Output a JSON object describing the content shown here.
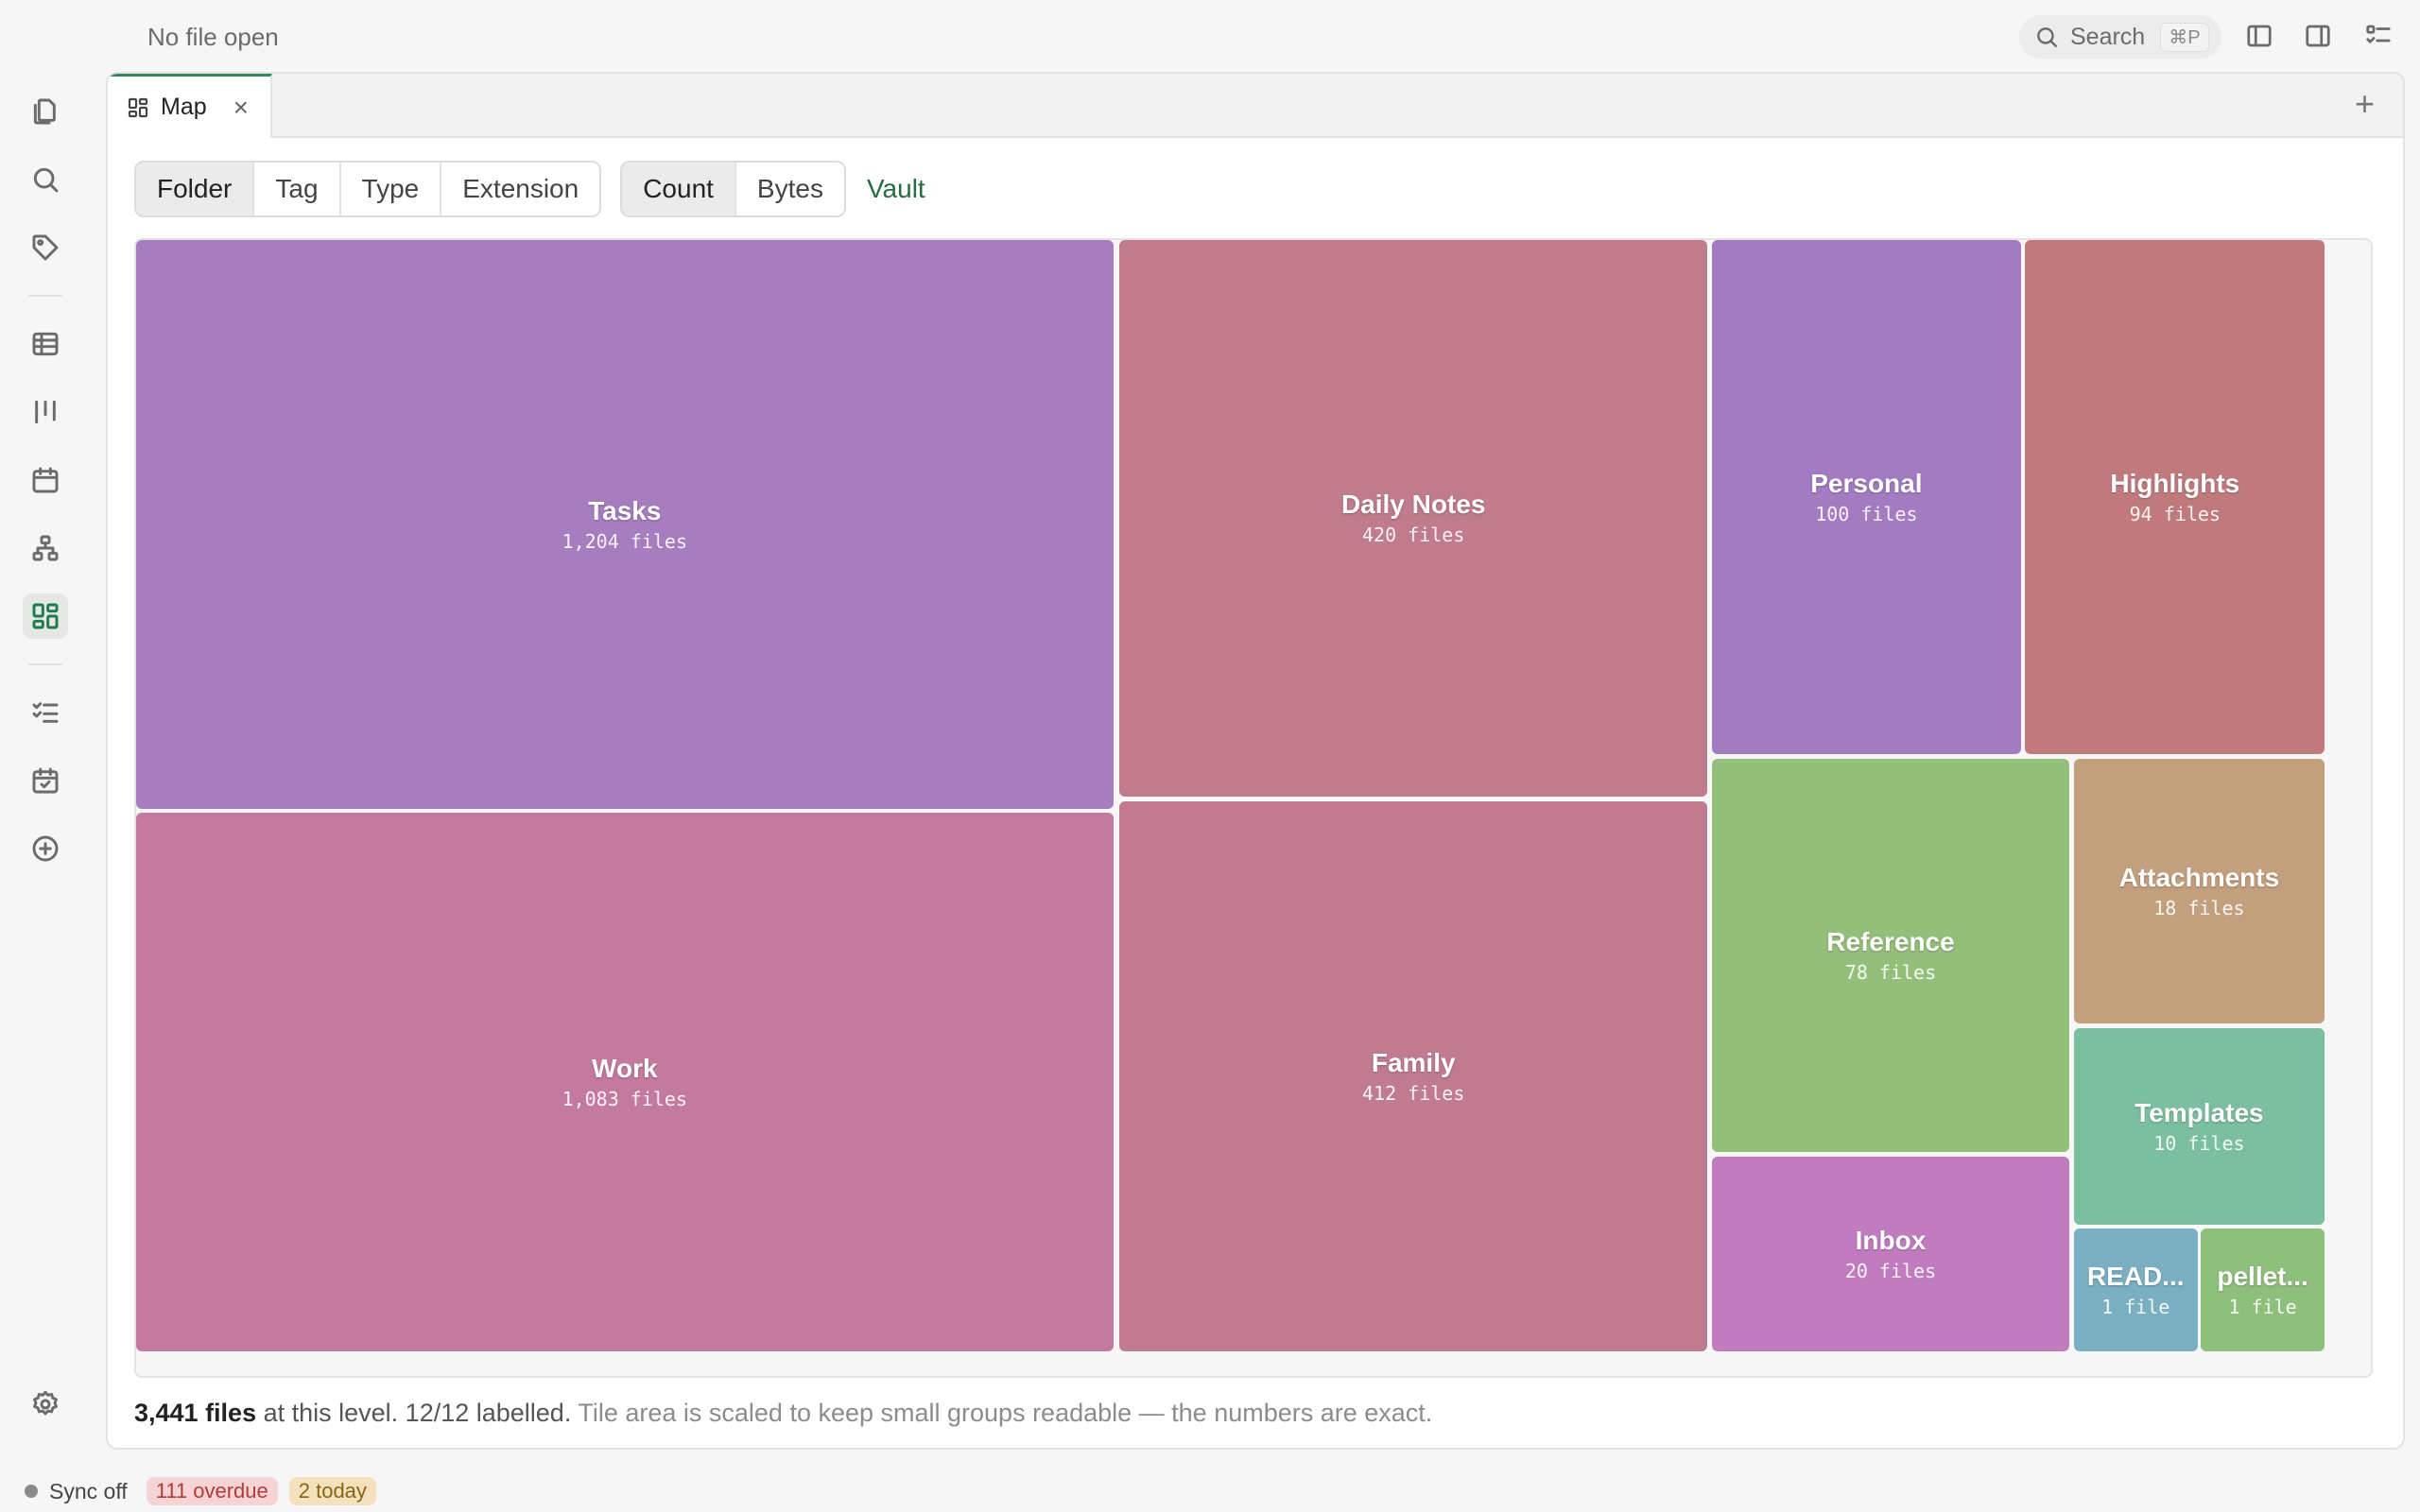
{
  "header": {
    "file_title": "No file open",
    "search_label": "Search",
    "search_shortcut": "⌘P"
  },
  "tab": {
    "label": "Map",
    "close": "×",
    "add": "+"
  },
  "group_by": {
    "options": [
      "Folder",
      "Tag",
      "Type",
      "Extension"
    ],
    "selected": "Folder"
  },
  "measure": {
    "options": [
      "Count",
      "Bytes"
    ],
    "selected": "Count"
  },
  "scope_link": "Vault",
  "tiles": [
    {
      "name": "Tasks",
      "count": "1,204 files",
      "color": "#a67dbf"
    },
    {
      "name": "Work",
      "count": "1,083 files",
      "color": "#c47a9e"
    },
    {
      "name": "Daily Notes",
      "count": "420 files",
      "color": "#c07b8c"
    },
    {
      "name": "Family",
      "count": "412 files",
      "color": "#c07b91"
    },
    {
      "name": "Personal",
      "count": "100 files",
      "color": "#a27bc0"
    },
    {
      "name": "Highlights",
      "count": "94 files",
      "color": "#c07a7e"
    },
    {
      "name": "Reference",
      "count": "78 files",
      "color": "#94bf7b"
    },
    {
      "name": "Attachments",
      "count": "18 files",
      "color": "#c2a07e"
    },
    {
      "name": "Templates",
      "count": "10 files",
      "color": "#7cbfa0"
    },
    {
      "name": "Inbox",
      "count": "20 files",
      "color": "#c07cbf"
    },
    {
      "name": "READ...",
      "count": "1 file",
      "color": "#7aafc2"
    },
    {
      "name": "pellet...",
      "count": "1 file",
      "color": "#8fbf7c"
    }
  ],
  "summary": {
    "count": "3,441 files",
    "text": "at this level. 12/12 labelled.",
    "note": "Tile area is scaled to keep small groups readable — the numbers are exact."
  },
  "status": {
    "sync": "Sync off",
    "overdue": "111 overdue",
    "today": "2 today"
  },
  "icons": {
    "ribbon": [
      "files-icon",
      "search-icon",
      "tag-icon",
      "table-icon",
      "kanban-icon",
      "calendar-icon",
      "graph-icon",
      "map-icon",
      "checklist-icon",
      "calendar-check-icon",
      "plus-circle-icon",
      "settings-icon"
    ],
    "top_right": [
      "left-sidebar-icon",
      "right-sidebar-icon",
      "outline-icon"
    ],
    "accent_color": "#1e7a4f"
  }
}
